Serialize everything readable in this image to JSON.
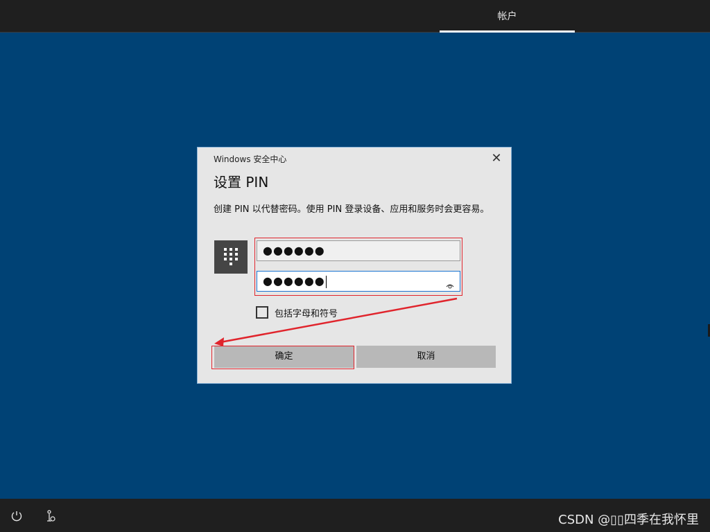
{
  "top_tab": {
    "label": "帐户"
  },
  "dialog": {
    "window_title": "Windows 安全中心",
    "close_glyph": "✕",
    "heading": "设置 PIN",
    "description": "创建 PIN 以代替密码。使用 PIN 登录设备、应用和服务时会更容易。",
    "pin_field": {
      "value": "●●●●●●"
    },
    "confirm_field": {
      "value": "●●●●●●"
    },
    "checkbox": {
      "label": "包括字母和符号",
      "checked": false
    },
    "ok_button": "确定",
    "cancel_button": "取消"
  },
  "icons": {
    "keypad": "keypad-icon",
    "eye": "eye-icon",
    "power": "power-icon",
    "accessibility": "accessibility-icon"
  },
  "colors": {
    "desktop_bg": "#004275",
    "bar_bg": "#1f1f1f",
    "dialog_bg": "#e6e6e6",
    "annotation_red": "#e0242c",
    "focus_blue": "#1a73d0"
  },
  "watermark": "CSDN @▯▯四季在我怀里"
}
